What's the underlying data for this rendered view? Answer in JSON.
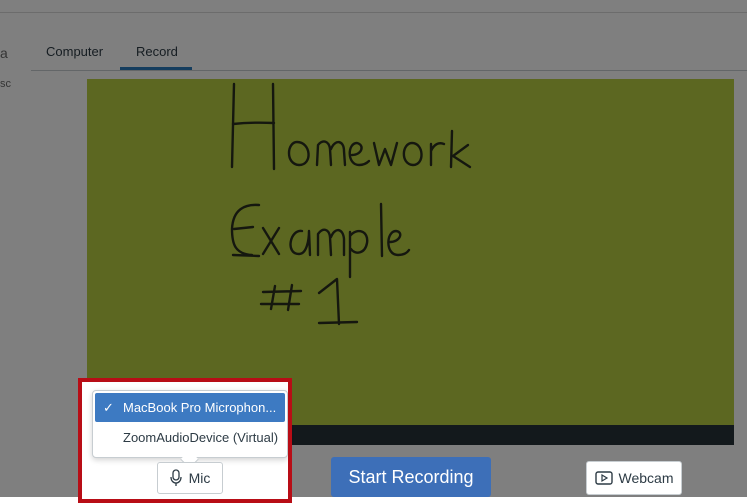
{
  "tabs": [
    {
      "label": "Computer",
      "active": false
    },
    {
      "label": "Record",
      "active": true
    }
  ],
  "accent_color": "#2b7abc",
  "video_preview": {
    "background_color": "#b8cf43",
    "handwritten_text": [
      "Homework",
      "Example",
      "#1"
    ]
  },
  "mic_menu": {
    "options": [
      {
        "label": "MacBook Pro Microphon...",
        "selected": true
      },
      {
        "label": "ZoomAudioDevice (Virtual)",
        "selected": false
      }
    ]
  },
  "controls": {
    "mic_button_label": "Mic",
    "mic_icon": "microphone-icon",
    "start_recording_label": "Start Recording",
    "webcam_button_label": "Webcam",
    "webcam_icon": "video-icon"
  },
  "left_edge": {
    "text1": "a",
    "text2": "sc"
  },
  "annotation": {
    "highlight_color": "#b80d16"
  }
}
